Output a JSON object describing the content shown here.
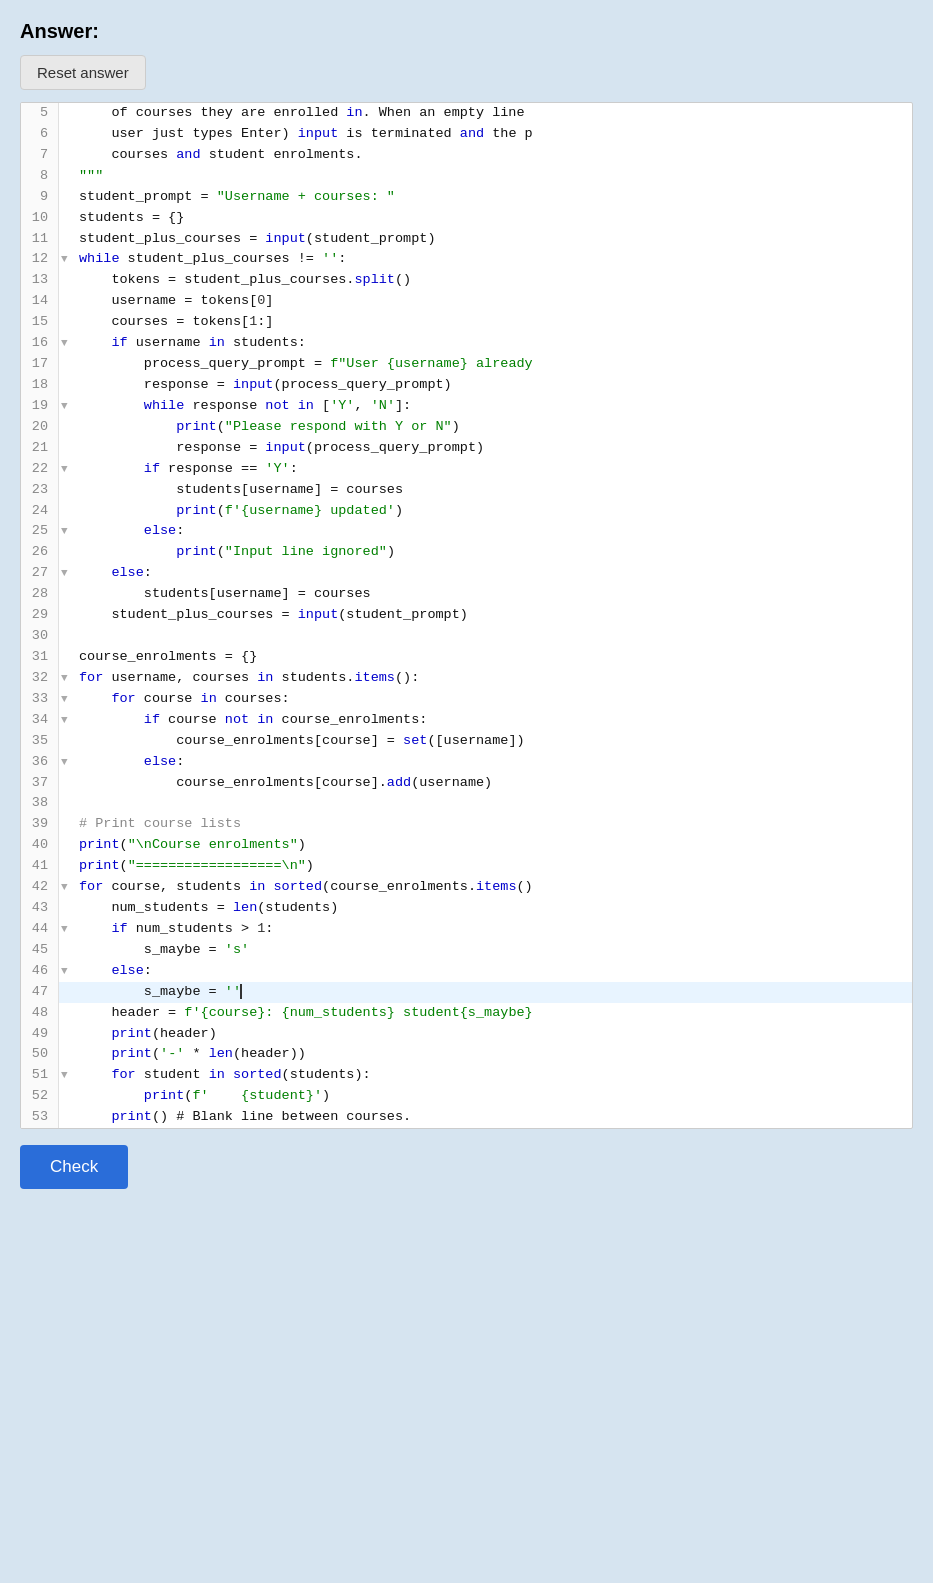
{
  "header": {
    "answer_label": "Answer:",
    "reset_button": "Reset answer"
  },
  "code": {
    "lines": [
      {
        "num": 5,
        "fold": "",
        "text": "    of courses they are enrolled in. When an empty line"
      },
      {
        "num": 6,
        "fold": "",
        "text": "    user just types Enter) input is terminated and the p"
      },
      {
        "num": 7,
        "fold": "",
        "text": "    courses and student enrolments."
      },
      {
        "num": 8,
        "fold": "",
        "text": "\"\"\""
      },
      {
        "num": 9,
        "fold": "",
        "text": "student_prompt = \"Username + courses: \""
      },
      {
        "num": 10,
        "fold": "",
        "text": "students = {}"
      },
      {
        "num": 11,
        "fold": "",
        "text": "student_plus_courses = input(student_prompt)"
      },
      {
        "num": 12,
        "fold": "▼",
        "text": "while student_plus_courses != '':"
      },
      {
        "num": 13,
        "fold": "",
        "text": "    tokens = student_plus_courses.split()"
      },
      {
        "num": 14,
        "fold": "",
        "text": "    username = tokens[0]"
      },
      {
        "num": 15,
        "fold": "",
        "text": "    courses = tokens[1:]"
      },
      {
        "num": 16,
        "fold": "▼",
        "text": "    if username in students:"
      },
      {
        "num": 17,
        "fold": "",
        "text": "        process_query_prompt = f\"User {username} already"
      },
      {
        "num": 18,
        "fold": "",
        "text": "        response = input(process_query_prompt)"
      },
      {
        "num": 19,
        "fold": "▼",
        "text": "        while response not in ['Y', 'N']:"
      },
      {
        "num": 20,
        "fold": "",
        "text": "            print(\"Please respond with Y or N\")"
      },
      {
        "num": 21,
        "fold": "",
        "text": "            response = input(process_query_prompt)"
      },
      {
        "num": 22,
        "fold": "▼",
        "text": "        if response == 'Y':"
      },
      {
        "num": 23,
        "fold": "",
        "text": "            students[username] = courses"
      },
      {
        "num": 24,
        "fold": "",
        "text": "            print(f'{username} updated')"
      },
      {
        "num": 25,
        "fold": "▼",
        "text": "        else:"
      },
      {
        "num": 26,
        "fold": "",
        "text": "            print(\"Input line ignored\")"
      },
      {
        "num": 27,
        "fold": "▼",
        "text": "    else:"
      },
      {
        "num": 28,
        "fold": "",
        "text": "        students[username] = courses"
      },
      {
        "num": 29,
        "fold": "",
        "text": "    student_plus_courses = input(student_prompt)"
      },
      {
        "num": 30,
        "fold": "",
        "text": ""
      },
      {
        "num": 31,
        "fold": "",
        "text": "course_enrolments = {}"
      },
      {
        "num": 32,
        "fold": "▼",
        "text": "for username, courses in students.items():"
      },
      {
        "num": 33,
        "fold": "▼",
        "text": "    for course in courses:"
      },
      {
        "num": 34,
        "fold": "▼",
        "text": "        if course not in course_enrolments:"
      },
      {
        "num": 35,
        "fold": "",
        "text": "            course_enrolments[course] = set([username])"
      },
      {
        "num": 36,
        "fold": "▼",
        "text": "        else:"
      },
      {
        "num": 37,
        "fold": "",
        "text": "            course_enrolments[course].add(username)"
      },
      {
        "num": 38,
        "fold": "",
        "text": ""
      },
      {
        "num": 39,
        "fold": "",
        "text": "# Print course lists"
      },
      {
        "num": 40,
        "fold": "",
        "text": "print(\"\\nCourse enrolments\")"
      },
      {
        "num": 41,
        "fold": "",
        "text": "print(\"==================\\n\")"
      },
      {
        "num": 42,
        "fold": "▼",
        "text": "for course, students in sorted(course_enrolments.items()"
      },
      {
        "num": 43,
        "fold": "",
        "text": "    num_students = len(students)"
      },
      {
        "num": 44,
        "fold": "▼",
        "text": "    if num_students > 1:"
      },
      {
        "num": 45,
        "fold": "",
        "text": "        s_maybe = 's'"
      },
      {
        "num": 46,
        "fold": "▼",
        "text": "    else:"
      },
      {
        "num": 47,
        "fold": "",
        "text": "        s_maybe = ''|",
        "highlight": true
      },
      {
        "num": 48,
        "fold": "",
        "text": "    header = f'{course}: {num_students} student{s_maybe}"
      },
      {
        "num": 49,
        "fold": "",
        "text": "    print(header)"
      },
      {
        "num": 50,
        "fold": "",
        "text": "    print('-' * len(header))"
      },
      {
        "num": 51,
        "fold": "▼",
        "text": "    for student in sorted(students):"
      },
      {
        "num": 52,
        "fold": "",
        "text": "        print(f'    {student}')"
      },
      {
        "num": 53,
        "fold": "",
        "text": "    print() # Blank line between courses."
      }
    ]
  },
  "footer": {
    "check_button": "Check"
  }
}
